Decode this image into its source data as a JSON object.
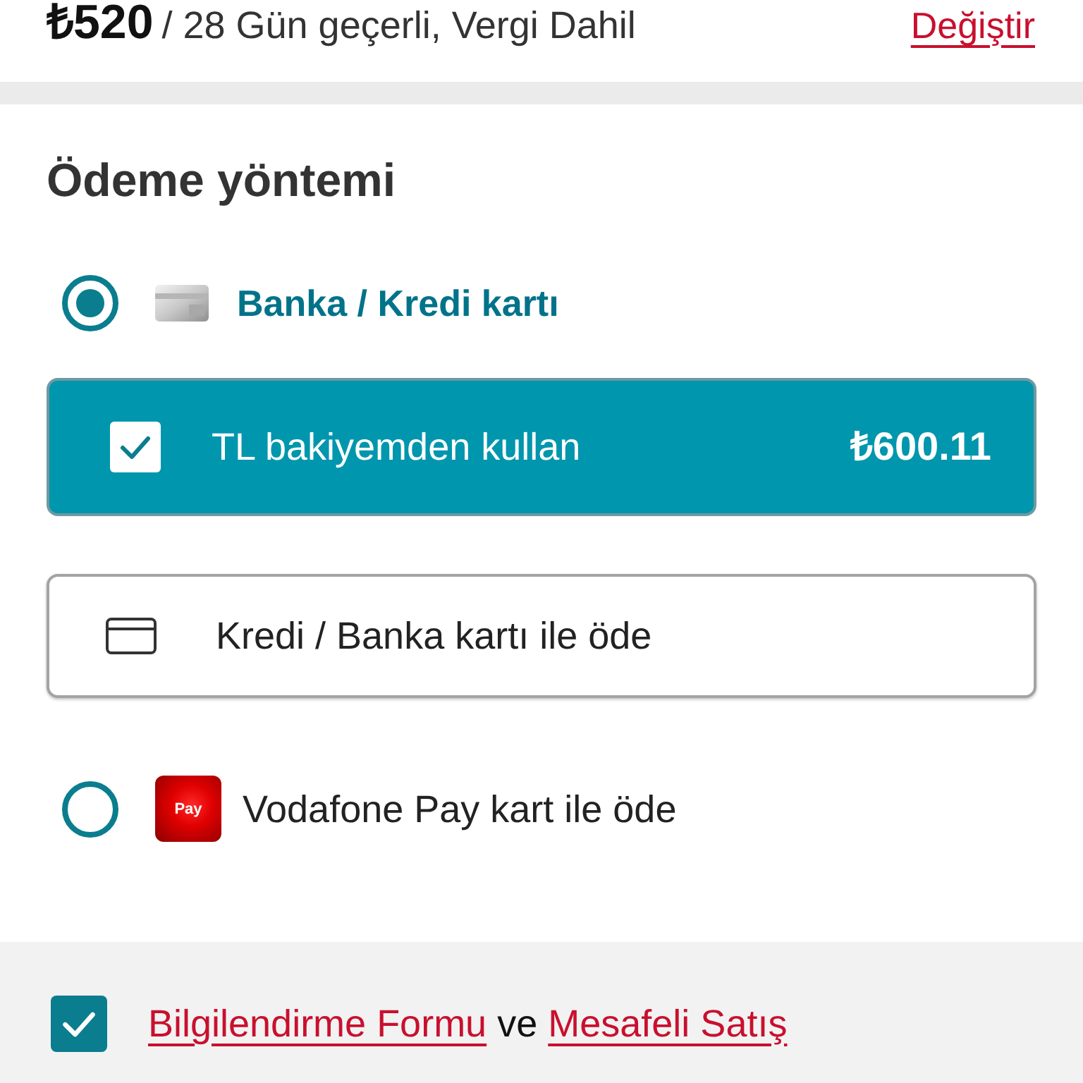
{
  "plan_summary": {
    "price": "₺520",
    "details": "/ 28 Gün geçerli, Vergi Dahil",
    "change_link": "Değiştir"
  },
  "payment": {
    "title": "Ödeme yöntemi",
    "methods": [
      {
        "kind": "bank_card",
        "label": "Banka / Kredi kartı",
        "selected": true,
        "options": [
          {
            "kind": "balance",
            "label": "TL bakiyemden kullan",
            "amount": "₺600.11",
            "checked": true
          },
          {
            "kind": "card",
            "label": "Kredi / Banka kartı ile öde"
          }
        ]
      },
      {
        "kind": "vodafone_pay",
        "label": "Vodafone Pay kart ile öde",
        "logo_text": "Pay",
        "selected": false
      }
    ]
  },
  "agreement": {
    "checked": true,
    "segments": [
      {
        "kind": "link",
        "text": "Bilgilendirme Formu"
      },
      {
        "kind": "text",
        "text": "ve"
      },
      {
        "kind": "link",
        "text": "Mesafeli Satış"
      }
    ]
  }
}
